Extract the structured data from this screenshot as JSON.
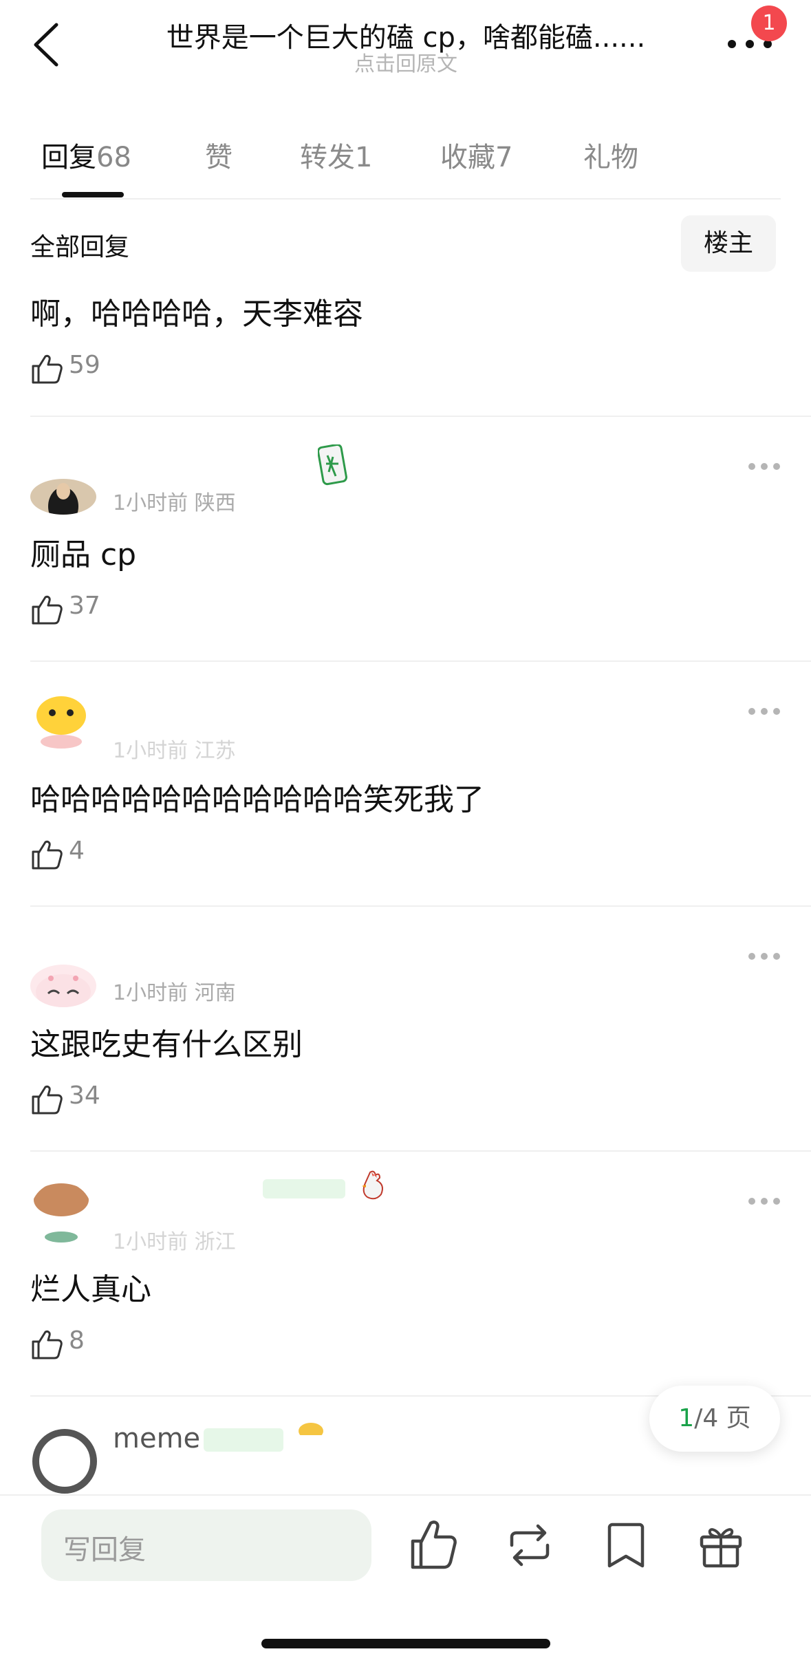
{
  "header": {
    "title": "世界是一个巨大的磕 cp，啥都能磕......",
    "subtitle": "点击回原文",
    "notification_count": "1"
  },
  "tabs": [
    {
      "label": "回复",
      "count": "68"
    },
    {
      "label": "赞",
      "count": ""
    },
    {
      "label": "转发",
      "count": "1"
    },
    {
      "label": "收藏",
      "count": "7"
    },
    {
      "label": "礼物",
      "count": ""
    }
  ],
  "section": {
    "title": "全部回复",
    "owner_filter": "楼主"
  },
  "comments": [
    {
      "text": "啊，哈哈哈哈，天李难容",
      "likes": "59"
    },
    {
      "meta": "1小时前 陕西",
      "text": "厕品 cp",
      "likes": "37"
    },
    {
      "meta": "1小时前 江苏",
      "text": "哈哈哈哈哈哈哈哈哈哈哈笑死我了",
      "likes": "4"
    },
    {
      "meta": "1小时前 河南",
      "text": "这跟吃史有什么区别",
      "likes": "34"
    },
    {
      "meta": "1小时前 浙江",
      "text": "烂人真心",
      "likes": "8"
    },
    {
      "username": "meme"
    }
  ],
  "pagination": {
    "current": "1",
    "total": "/4 页"
  },
  "bottom_bar": {
    "reply_placeholder": "写回复",
    "icons": [
      "like-icon",
      "repost-icon",
      "bookmark-icon",
      "gift-icon"
    ]
  },
  "colors": {
    "accent_green": "#1aa24a",
    "badge_red": "#f3484e"
  }
}
